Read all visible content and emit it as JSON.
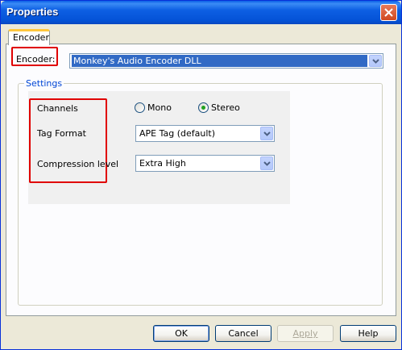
{
  "window": {
    "title": "Properties"
  },
  "tabs": [
    {
      "label": "Encoder",
      "selected": true
    }
  ],
  "encoder": {
    "label": "Encoder:",
    "selected_value": "Monkey's Audio Encoder DLL"
  },
  "settings": {
    "caption": "Settings",
    "channels": {
      "label": "Channels",
      "options": [
        {
          "label": "Mono",
          "checked": false
        },
        {
          "label": "Stereo",
          "checked": true
        }
      ]
    },
    "tag_format": {
      "label": "Tag Format",
      "value": "APE Tag (default)"
    },
    "compression": {
      "label": "Compression level",
      "value": "Extra High"
    }
  },
  "buttons": {
    "ok": "OK",
    "cancel": "Cancel",
    "apply": "Apply",
    "help": "Help"
  },
  "colors": {
    "highlight_box": "#e00000",
    "title_bar": "#0452d6",
    "selection": "#316ac5"
  }
}
